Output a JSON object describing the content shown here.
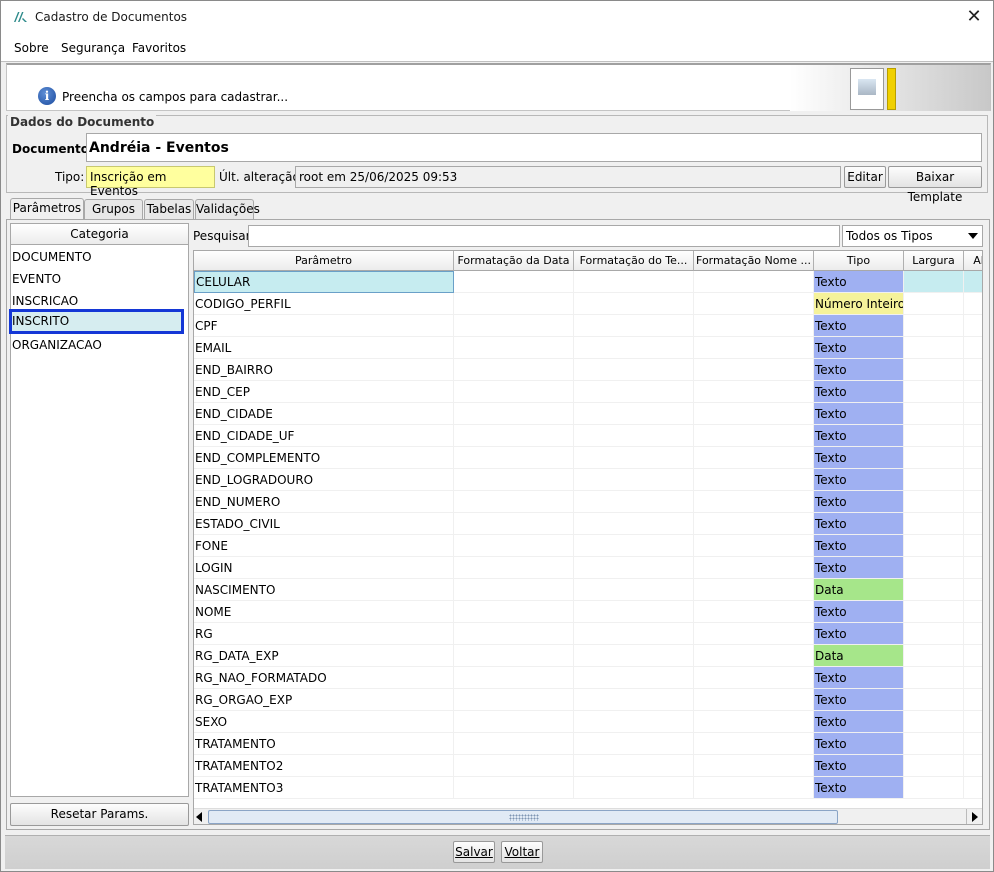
{
  "window": {
    "title": "Cadastro de Documentos",
    "close_glyph": "✕"
  },
  "menu": [
    {
      "label": "Sobre"
    },
    {
      "label": "Segurança"
    },
    {
      "label": "Favoritos"
    }
  ],
  "info": {
    "message": "Preencha os campos para cadastrar...",
    "icon": "info-icon",
    "icon_glyph": "i"
  },
  "dados": {
    "legend": "Dados do Documento",
    "documento_label": "Documento:",
    "documento_value": "Andréia - Eventos",
    "tipo_label": "Tipo:",
    "tipo_value": "Inscrição em Eventos",
    "alteracao_label": "Últ. alteração:",
    "alteracao_value": "root em 25/06/2025 09:53",
    "editar_label": "Editar",
    "baixar_label": "Baixar Template"
  },
  "tabs": [
    {
      "label": "Parâmetros"
    },
    {
      "label": "Grupos"
    },
    {
      "label": "Tabelas"
    },
    {
      "label": "Validações"
    }
  ],
  "categoria": {
    "header": "Categoria",
    "items": [
      "DOCUMENTO",
      "EVENTO",
      "INSCRICAO",
      "INSCRITO",
      "ORGANIZACAO"
    ],
    "selected": "INSCRITO",
    "reset_label": "Resetar Params."
  },
  "search": {
    "label": "Pesquisar:",
    "value": "",
    "filter_value": "Todos os Tipos"
  },
  "grid": {
    "columns": [
      "Parâmetro",
      "Formatação da Data",
      "Formatação do Te...",
      "Formatação Nome ...",
      "Tipo",
      "Largura",
      "Al"
    ],
    "rows": [
      [
        "CELULAR",
        "Texto"
      ],
      [
        "CODIGO_PERFIL",
        "Número Inteiro"
      ],
      [
        "CPF",
        "Texto"
      ],
      [
        "EMAIL",
        "Texto"
      ],
      [
        "END_BAIRRO",
        "Texto"
      ],
      [
        "END_CEP",
        "Texto"
      ],
      [
        "END_CIDADE",
        "Texto"
      ],
      [
        "END_CIDADE_UF",
        "Texto"
      ],
      [
        "END_COMPLEMENTO",
        "Texto"
      ],
      [
        "END_LOGRADOURO",
        "Texto"
      ],
      [
        "END_NUMERO",
        "Texto"
      ],
      [
        "ESTADO_CIVIL",
        "Texto"
      ],
      [
        "FONE",
        "Texto"
      ],
      [
        "LOGIN",
        "Texto"
      ],
      [
        "NASCIMENTO",
        "Data"
      ],
      [
        "NOME",
        "Texto"
      ],
      [
        "RG",
        "Texto"
      ],
      [
        "RG_DATA_EXP",
        "Data"
      ],
      [
        "RG_NAO_FORMATADO",
        "Texto"
      ],
      [
        "RG_ORGAO_EXP",
        "Texto"
      ],
      [
        "SEXO",
        "Texto"
      ],
      [
        "TRATAMENTO",
        "Texto"
      ],
      [
        "TRATAMENTO2",
        "Texto"
      ],
      [
        "TRATAMENTO3",
        "Texto"
      ]
    ],
    "selected_row": "CELULAR",
    "type_colors": {
      "Texto": "#9fb0f2",
      "Número Inteiro": "#f5f29a",
      "Data": "#a6e68a",
      "selected": "#c6ecf0"
    }
  },
  "footer": {
    "salvar_label": "Salvar",
    "voltar_label": "Voltar"
  }
}
